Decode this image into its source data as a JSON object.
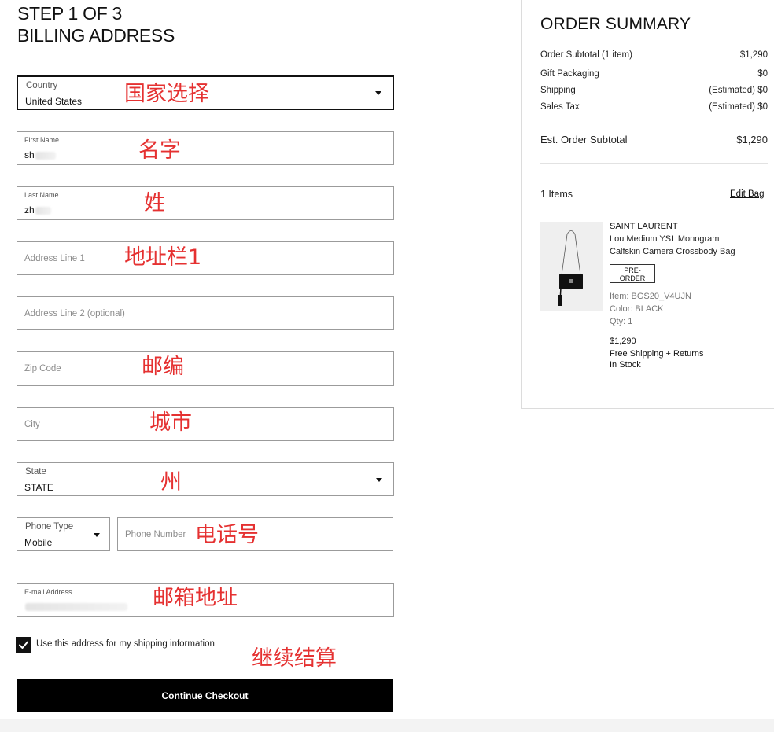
{
  "step": {
    "line1": "STEP 1 OF 3",
    "line2": "BILLING ADDRESS"
  },
  "form": {
    "country": {
      "label": "Country",
      "value": "United States",
      "annotation": "国家选择"
    },
    "first_name": {
      "label": "First Name",
      "value": "sh",
      "annotation": "名字"
    },
    "last_name": {
      "label": "Last Name",
      "value": "zh",
      "annotation": "姓"
    },
    "address1": {
      "placeholder": "Address Line 1",
      "annotation": "地址栏1"
    },
    "address2": {
      "placeholder": "Address Line 2 (optional)"
    },
    "zip": {
      "placeholder": "Zip Code",
      "annotation": "邮编"
    },
    "city": {
      "placeholder": "City",
      "annotation": "城市"
    },
    "state": {
      "label": "State",
      "value": "STATE",
      "annotation": "州"
    },
    "phone_type": {
      "label": "Phone Type",
      "value": "Mobile"
    },
    "phone_number": {
      "placeholder": "Phone Number",
      "annotation": "电话号"
    },
    "email": {
      "label": "E-mail Address",
      "annotation": "邮箱地址"
    },
    "use_for_shipping": {
      "label": "Use this address for my shipping information",
      "checked": true
    },
    "continue": {
      "label": "Continue Checkout",
      "annotation": "继续结算"
    }
  },
  "summary": {
    "title": "ORDER SUMMARY",
    "rows": [
      {
        "label": "Order Subtotal (1 item)",
        "value": "$1,290"
      },
      {
        "label": "Gift Packaging",
        "value": "$0"
      },
      {
        "label": "Shipping",
        "value": "(Estimated) $0"
      },
      {
        "label": "Sales Tax",
        "value": "(Estimated) $0"
      }
    ],
    "total": {
      "label": "Est. Order Subtotal",
      "value": "$1,290"
    },
    "items_count": "1 Items",
    "edit_bag": "Edit Bag",
    "product": {
      "brand": "SAINT LAURENT",
      "name_line1": "Lou Medium YSL Monogram",
      "name_line2": "Calfskin Camera Crossbody Bag",
      "badge_line1": "PRE-",
      "badge_line2": "ORDER",
      "item": "Item: BGS20_V4UJN",
      "color": "Color: BLACK",
      "qty": "Qty: 1",
      "price": "$1,290",
      "shipping": "Free Shipping + Returns",
      "stock": "In Stock"
    }
  },
  "colors": {
    "accent": "#000000",
    "annotation": "#e53131",
    "border": "#9b9b9b"
  }
}
